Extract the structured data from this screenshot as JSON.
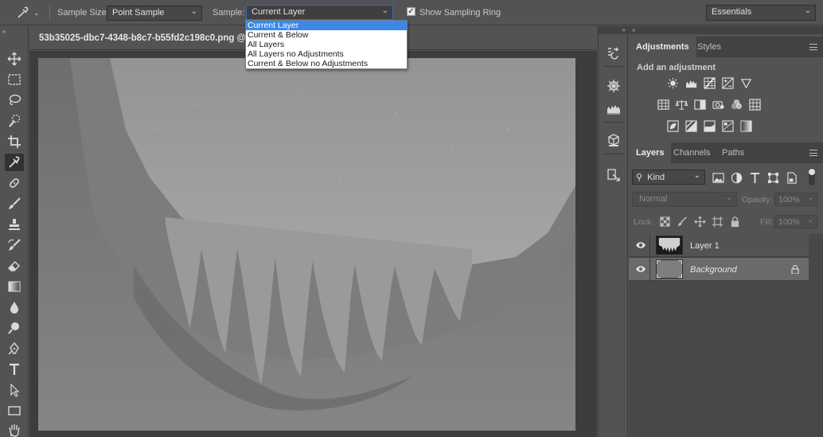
{
  "options_bar": {
    "sample_size_label": "Sample Size:",
    "sample_size_value": "Point Sample",
    "sample_label": "Sample:",
    "sample_value": "Current Layer",
    "show_ring_label": "Show Sampling Ring",
    "show_ring_checked": true,
    "workspace_value": "Essentials"
  },
  "sample_menu": {
    "items": [
      "Current Layer",
      "Current & Below",
      "All Layers",
      "All Layers no Adjustments",
      "Current & Below no Adjustments"
    ],
    "selected_index": 0
  },
  "document": {
    "tab_title": "53b35025-dbc7-4348-b8c7-b55fd2c198c0.png @ 33"
  },
  "tools": [
    "move-tool",
    "marquee-tool",
    "lasso-tool",
    "quick-selection-tool",
    "crop-tool",
    "eyedropper-tool",
    "healing-brush-tool",
    "brush-tool",
    "clone-stamp-tool",
    "history-brush-tool",
    "eraser-tool",
    "gradient-tool",
    "blur-tool",
    "dodge-tool",
    "pen-tool",
    "type-tool",
    "path-selection-tool",
    "rectangle-tool",
    "hand-tool"
  ],
  "active_tool": "eyedropper-tool",
  "adjustments_panel": {
    "tabs": [
      "Adjustments",
      "Styles"
    ],
    "active_tab": "Adjustments",
    "title": "Add an adjustment"
  },
  "layers_panel": {
    "tabs": [
      "Layers",
      "Channels",
      "Paths"
    ],
    "active_tab": "Layers",
    "filter_label": "Kind",
    "blend_mode": "Normal",
    "opacity_label": "Opacity:",
    "opacity_value": "100%",
    "lock_label": "Lock:",
    "fill_label": "Fill:",
    "fill_value": "100%",
    "layers": [
      {
        "name": "Layer 1",
        "visible": true,
        "locked": false,
        "selected": false
      },
      {
        "name": "Background",
        "visible": true,
        "locked": true,
        "selected": true
      }
    ]
  },
  "colors": {
    "selection_blue": "#3b88e8",
    "panel_bg": "#535353",
    "panel_dark": "#424242"
  }
}
